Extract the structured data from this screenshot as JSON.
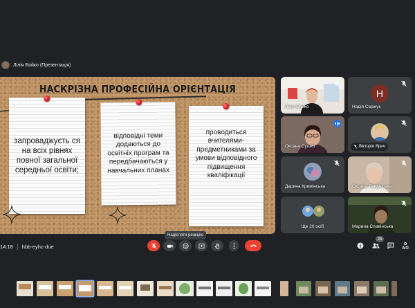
{
  "presenter_bar": {
    "label": "Лілія Бойко (Презентація)"
  },
  "slide": {
    "title": "НАСКРІЗНА ПРОФЕСІЙНА ОРІЄНТАЦІЯ",
    "notes": [
      {
        "text": "запроваджуєть ся на всіх рівнях повної загальної середньої освіти;"
      },
      {
        "text": "відповідні теми додаються до освітніх програм та передбачаються у навчальних планах"
      },
      {
        "text": "проводиться вчителями-предметниками за умови відповідного підвищення кваліфікації"
      }
    ],
    "pin_color": "#d61515"
  },
  "participants": [
    {
      "name": "Лілія Бойко"
    },
    {
      "name": "Надія Сержук",
      "avatar_letter": "H"
    },
    {
      "name": "Оксана Сушко"
    },
    {
      "name": "Вікторія Ярич"
    },
    {
      "name": "Дарина Кримінська"
    },
    {
      "name": "Оксана Лавдінська"
    },
    {
      "name": "Ще 20 осіб"
    },
    {
      "name": "Марина Славінська"
    }
  ],
  "controls": {
    "tooltip": "Надіслати реакцію",
    "time": "14:18",
    "meeting_code": "hbb-eyhc-due",
    "participant_count": "28"
  },
  "icons": [
    "mic-off-icon",
    "camera-icon",
    "emoji-icon",
    "present-icon",
    "raise-hand-icon",
    "more-icon",
    "end-call-icon",
    "info-icon",
    "people-icon",
    "chat-icon",
    "activities-icon"
  ],
  "colors": {
    "background": "#202124",
    "end_call": "#ea4335",
    "speaking": "#8ab4f8"
  }
}
